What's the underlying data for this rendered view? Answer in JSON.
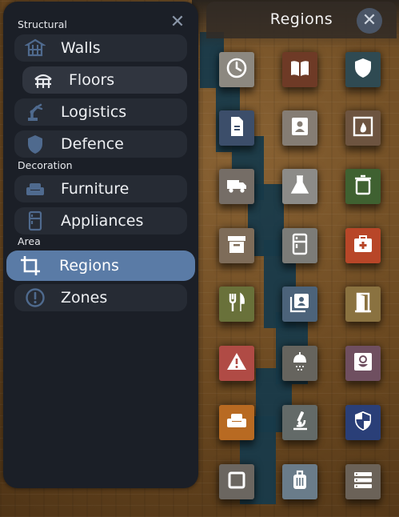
{
  "left_panel": {
    "close_glyph": "✕",
    "sections": [
      {
        "label": "Structural"
      },
      {
        "label": "Decoration"
      },
      {
        "label": "Area"
      }
    ],
    "items": [
      {
        "label": "Walls",
        "icon": "walls-icon"
      },
      {
        "label": "Floors",
        "icon": "floors-icon"
      },
      {
        "label": "Logistics",
        "icon": "robot-arm-icon"
      },
      {
        "label": "Defence",
        "icon": "shield-icon"
      },
      {
        "label": "Furniture",
        "icon": "sofa-icon"
      },
      {
        "label": "Appliances",
        "icon": "fridge-icon"
      },
      {
        "label": "Regions",
        "icon": "crop-icon",
        "selected": true
      },
      {
        "label": "Zones",
        "icon": "alert-circle-icon"
      }
    ]
  },
  "regions_panel": {
    "title": "Regions",
    "close_glyph": "✕",
    "tiles": [
      {
        "icon": "clock-icon",
        "color": "#8c8880"
      },
      {
        "icon": "book-icon",
        "color": "#6e3a26"
      },
      {
        "icon": "shield-icon",
        "color": "#2f4a52"
      },
      {
        "icon": "document-icon",
        "color": "#3c4e6a"
      },
      {
        "icon": "contact-card-icon",
        "color": "#857d74"
      },
      {
        "icon": "fireplace-icon",
        "color": "#6d5440"
      },
      {
        "icon": "truck-icon",
        "color": "#756d66"
      },
      {
        "icon": "flask-icon",
        "color": "#8c8b88"
      },
      {
        "icon": "trash-icon",
        "color": "#3f6131"
      },
      {
        "icon": "archive-box-icon",
        "color": "#7e6c59"
      },
      {
        "icon": "fridge-icon",
        "color": "#7c7c78"
      },
      {
        "icon": "first-aid-icon",
        "color": "#b84628"
      },
      {
        "icon": "cutlery-icon",
        "color": "#69713a"
      },
      {
        "icon": "contacts-book-icon",
        "color": "#4c637a"
      },
      {
        "icon": "door-exit-icon",
        "color": "#8a7240"
      },
      {
        "icon": "warning-icon",
        "color": "#b04b45"
      },
      {
        "icon": "shower-icon",
        "color": "#66645e"
      },
      {
        "icon": "flower-icon",
        "color": "#6f4f60"
      },
      {
        "icon": "armchair-icon",
        "color": "#b86a22"
      },
      {
        "icon": "microscope-icon",
        "color": "#636a68"
      },
      {
        "icon": "security-shield-icon",
        "color": "#2a3f78"
      },
      {
        "icon": "square-icon",
        "color": "#6b6660"
      },
      {
        "icon": "luggage-icon",
        "color": "#6a7c8a"
      },
      {
        "icon": "list-icon",
        "color": "#6b6258"
      }
    ]
  }
}
